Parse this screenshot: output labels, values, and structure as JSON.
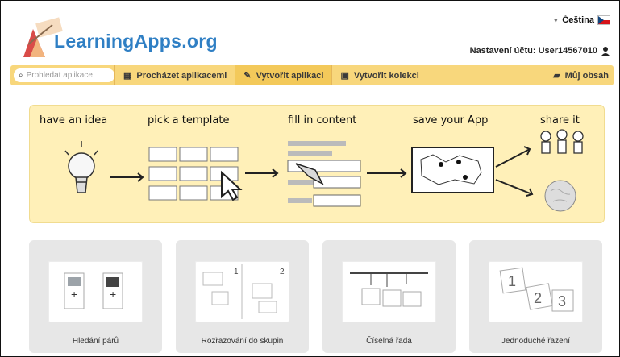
{
  "app": {
    "logo_text": "LearningApps.org",
    "language": "Čeština",
    "account": "Nastavení účtu: User14567010"
  },
  "nav": {
    "search_placeholder": "Prohledat aplikace",
    "items": [
      {
        "label": "Procházet aplikacemi"
      },
      {
        "label": "Vytvořit aplikaci"
      },
      {
        "label": "Vytvořit kolekci"
      }
    ],
    "my_content": "Můj obsah"
  },
  "banner": {
    "steps": [
      {
        "label": "have an idea"
      },
      {
        "label": "pick a template"
      },
      {
        "label": "fill in content"
      },
      {
        "label": "save your App"
      },
      {
        "label": "share it"
      }
    ]
  },
  "cards": [
    {
      "title": "Hledání párů"
    },
    {
      "title": "Rozřazování do skupin"
    },
    {
      "title": "Číselná řada"
    },
    {
      "title": "Jednoduché řazení"
    }
  ],
  "colors": {
    "logo_blue": "#2f7fc4",
    "nav_yellow": "#f8d77c",
    "banner_bg": "#fff0b8",
    "card_gray": "#e7e7e7"
  }
}
